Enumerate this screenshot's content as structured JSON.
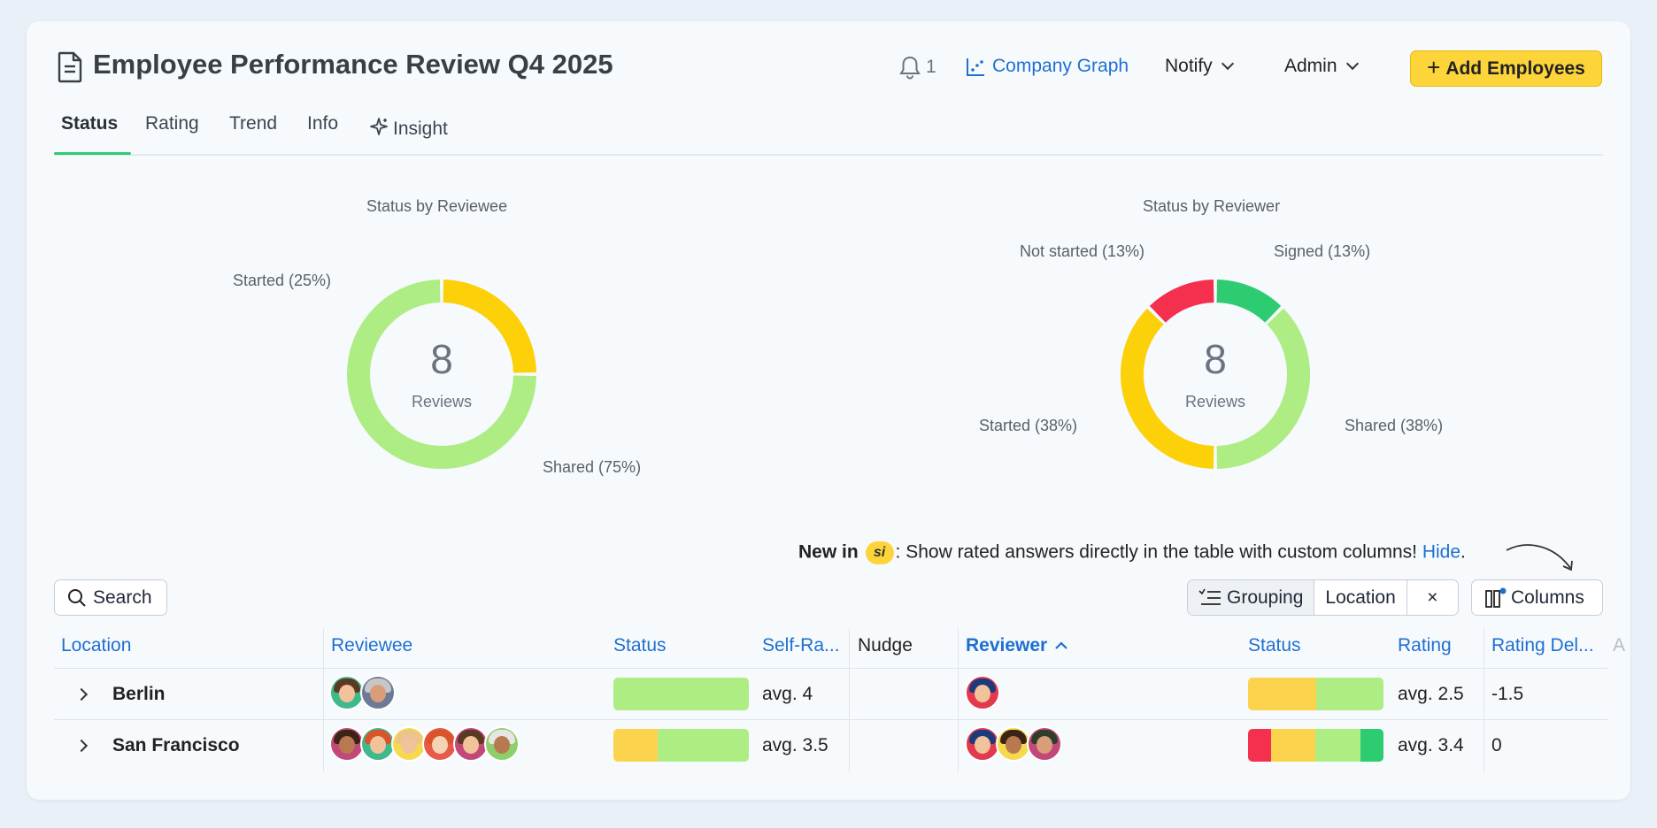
{
  "header": {
    "title": "Employee Performance Review Q4 2025",
    "notification_count": "1",
    "company_graph_label": "Company Graph",
    "notify_label": "Notify",
    "admin_label": "Admin",
    "add_employees_label": "Add Employees"
  },
  "tabs": [
    {
      "label": "Status",
      "active": true
    },
    {
      "label": "Rating",
      "active": false
    },
    {
      "label": "Trend",
      "active": false
    },
    {
      "label": "Info",
      "active": false
    },
    {
      "label": "Insight",
      "active": false
    }
  ],
  "chart_data": [
    {
      "type": "pie",
      "title": "Status by Reviewee",
      "center_value": "8",
      "center_label": "Reviews",
      "slices": [
        {
          "label": "Started (25%)",
          "value": 25,
          "color": "#fcd10a"
        },
        {
          "label": "Shared (75%)",
          "value": 75,
          "color": "#aeec84"
        }
      ]
    },
    {
      "type": "pie",
      "title": "Status by Reviewer",
      "center_value": "8",
      "center_label": "Reviews",
      "slices": [
        {
          "label": "Signed (13%)",
          "value": 12.5,
          "color": "#2ecc71"
        },
        {
          "label": "Shared (38%)",
          "value": 37.5,
          "color": "#aeec84"
        },
        {
          "label": "Started (38%)",
          "value": 37.5,
          "color": "#fcd10a"
        },
        {
          "label": "Not started (13%)",
          "value": 12.5,
          "color": "#f5304f"
        }
      ]
    }
  ],
  "promo": {
    "new_in": "New in",
    "badge": "si",
    "message": ": Show rated answers directly in the table with custom columns!",
    "hide_label": "Hide",
    "end": "."
  },
  "toolbar": {
    "search_label": "Search",
    "grouping_label": "Grouping",
    "grouping_value": "Location",
    "clear_label": "×",
    "columns_label": "Columns"
  },
  "table": {
    "headers": {
      "location": "Location",
      "reviewee": "Reviewee",
      "status": "Status",
      "self_rating": "Self-Ra...",
      "nudge": "Nudge",
      "reviewer": "Reviewer",
      "reviewer_status": "Status",
      "rating": "Rating",
      "rating_delta": "Rating Del...",
      "next": "A"
    },
    "rows": [
      {
        "location": "Berlin",
        "self_rating": "avg. 4",
        "rating": "avg. 2.5",
        "rating_delta": "-1.5",
        "reviewee_status": [
          {
            "color": "#aeec84",
            "value": 1
          }
        ],
        "reviewer_status": [
          {
            "color": "#fcd34d",
            "value": 0.5
          },
          {
            "color": "#aeec84",
            "value": 0.5
          }
        ]
      },
      {
        "location": "San Francisco",
        "self_rating": "avg. 3.5",
        "rating": "avg. 3.4",
        "rating_delta": "0",
        "reviewee_status": [
          {
            "color": "#fcd34d",
            "value": 0.33
          },
          {
            "color": "#aeec84",
            "value": 0.67
          }
        ],
        "reviewer_status": [
          {
            "color": "#f5304f",
            "value": 0.17
          },
          {
            "color": "#fcd34d",
            "value": 0.33
          },
          {
            "color": "#aeec84",
            "value": 0.33
          },
          {
            "color": "#2ecc71",
            "value": 0.17
          }
        ]
      }
    ]
  }
}
